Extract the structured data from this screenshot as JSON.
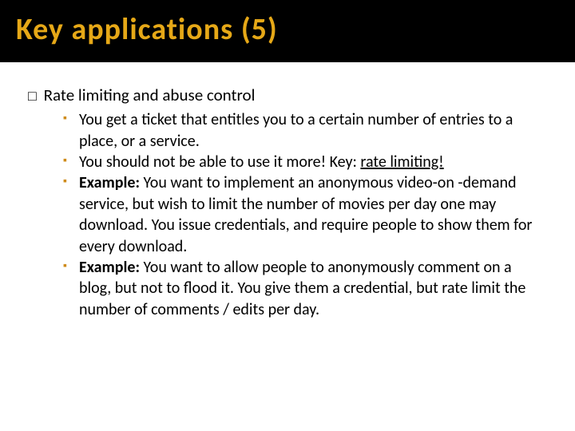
{
  "title": "Key applications (5)",
  "top_bullet": "Rate limiting and abuse control",
  "bullets": [
    {
      "text": "You get a ticket that entitles you to a certain number of entries to a place, or a service."
    },
    {
      "text_pre": "You should not be able to use it more! Key: ",
      "underlined": "rate limiting!"
    },
    {
      "label": "Example:",
      "text": " You want to implement an anonymous video-on -demand service, but wish to limit the number of movies per day one may download. You issue credentials, and require people to show them for every download."
    },
    {
      "label": "Example:",
      "text": " You want to allow people to anonymously comment on a blog, but not to flood it. You give them a credential, but rate limit the number of comments / edits per day."
    }
  ]
}
